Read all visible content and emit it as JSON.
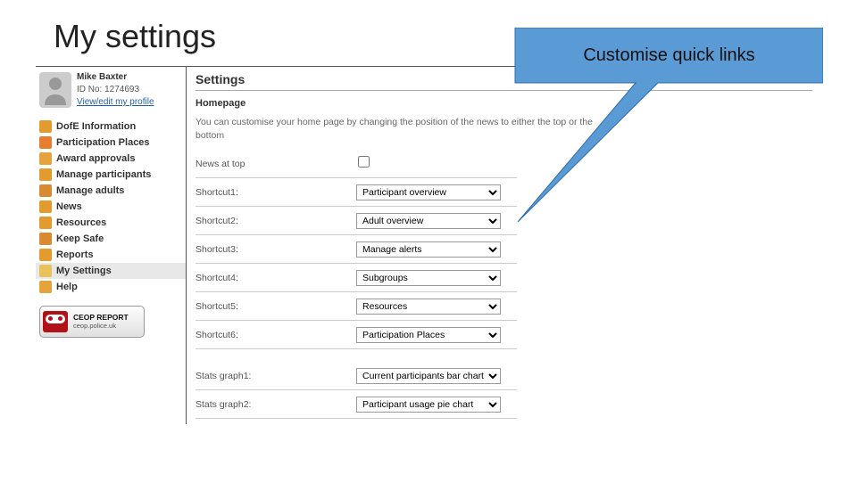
{
  "slide_title": "My settings",
  "callout": {
    "text": "Customise quick links"
  },
  "profile": {
    "name": "Mike Baxter",
    "id_label": "ID No: 1274693",
    "edit_link": "View/edit my profile"
  },
  "nav": [
    {
      "label": "DofE Information",
      "color": "#e39b2e"
    },
    {
      "label": "Participation Places",
      "color": "#e87d2f"
    },
    {
      "label": "Award approvals",
      "color": "#e6a23c"
    },
    {
      "label": "Manage participants",
      "color": "#e39b2e"
    },
    {
      "label": "Manage adults",
      "color": "#d9892f"
    },
    {
      "label": "News",
      "color": "#e39b2e"
    },
    {
      "label": "Resources",
      "color": "#e39b2e"
    },
    {
      "label": "Keep Safe",
      "color": "#d9892f"
    },
    {
      "label": "Reports",
      "color": "#e39b2e"
    },
    {
      "label": "My Settings",
      "color": "#e8c15a",
      "selected": true
    },
    {
      "label": "Help",
      "color": "#e6a23c"
    }
  ],
  "ceop": {
    "line1": "CEOP REPORT",
    "line2": "ceop.police.uk"
  },
  "settings": {
    "title": "Settings",
    "section": "Homepage",
    "description": "You can customise your home page by changing the position of the news to either the top or the bottom",
    "news_at_top_label": "News at top",
    "rows": [
      {
        "label": "Shortcut1:",
        "value": "Participant overview"
      },
      {
        "label": "Shortcut2:",
        "value": "Adult overview"
      },
      {
        "label": "Shortcut3:",
        "value": "Manage alerts"
      },
      {
        "label": "Shortcut4:",
        "value": "Subgroups"
      },
      {
        "label": "Shortcut5:",
        "value": "Resources"
      },
      {
        "label": "Shortcut6:",
        "value": "Participation Places"
      }
    ],
    "stats": [
      {
        "label": "Stats graph1:",
        "value": "Current participants bar chart"
      },
      {
        "label": "Stats graph2:",
        "value": "Participant usage pie chart"
      }
    ]
  }
}
